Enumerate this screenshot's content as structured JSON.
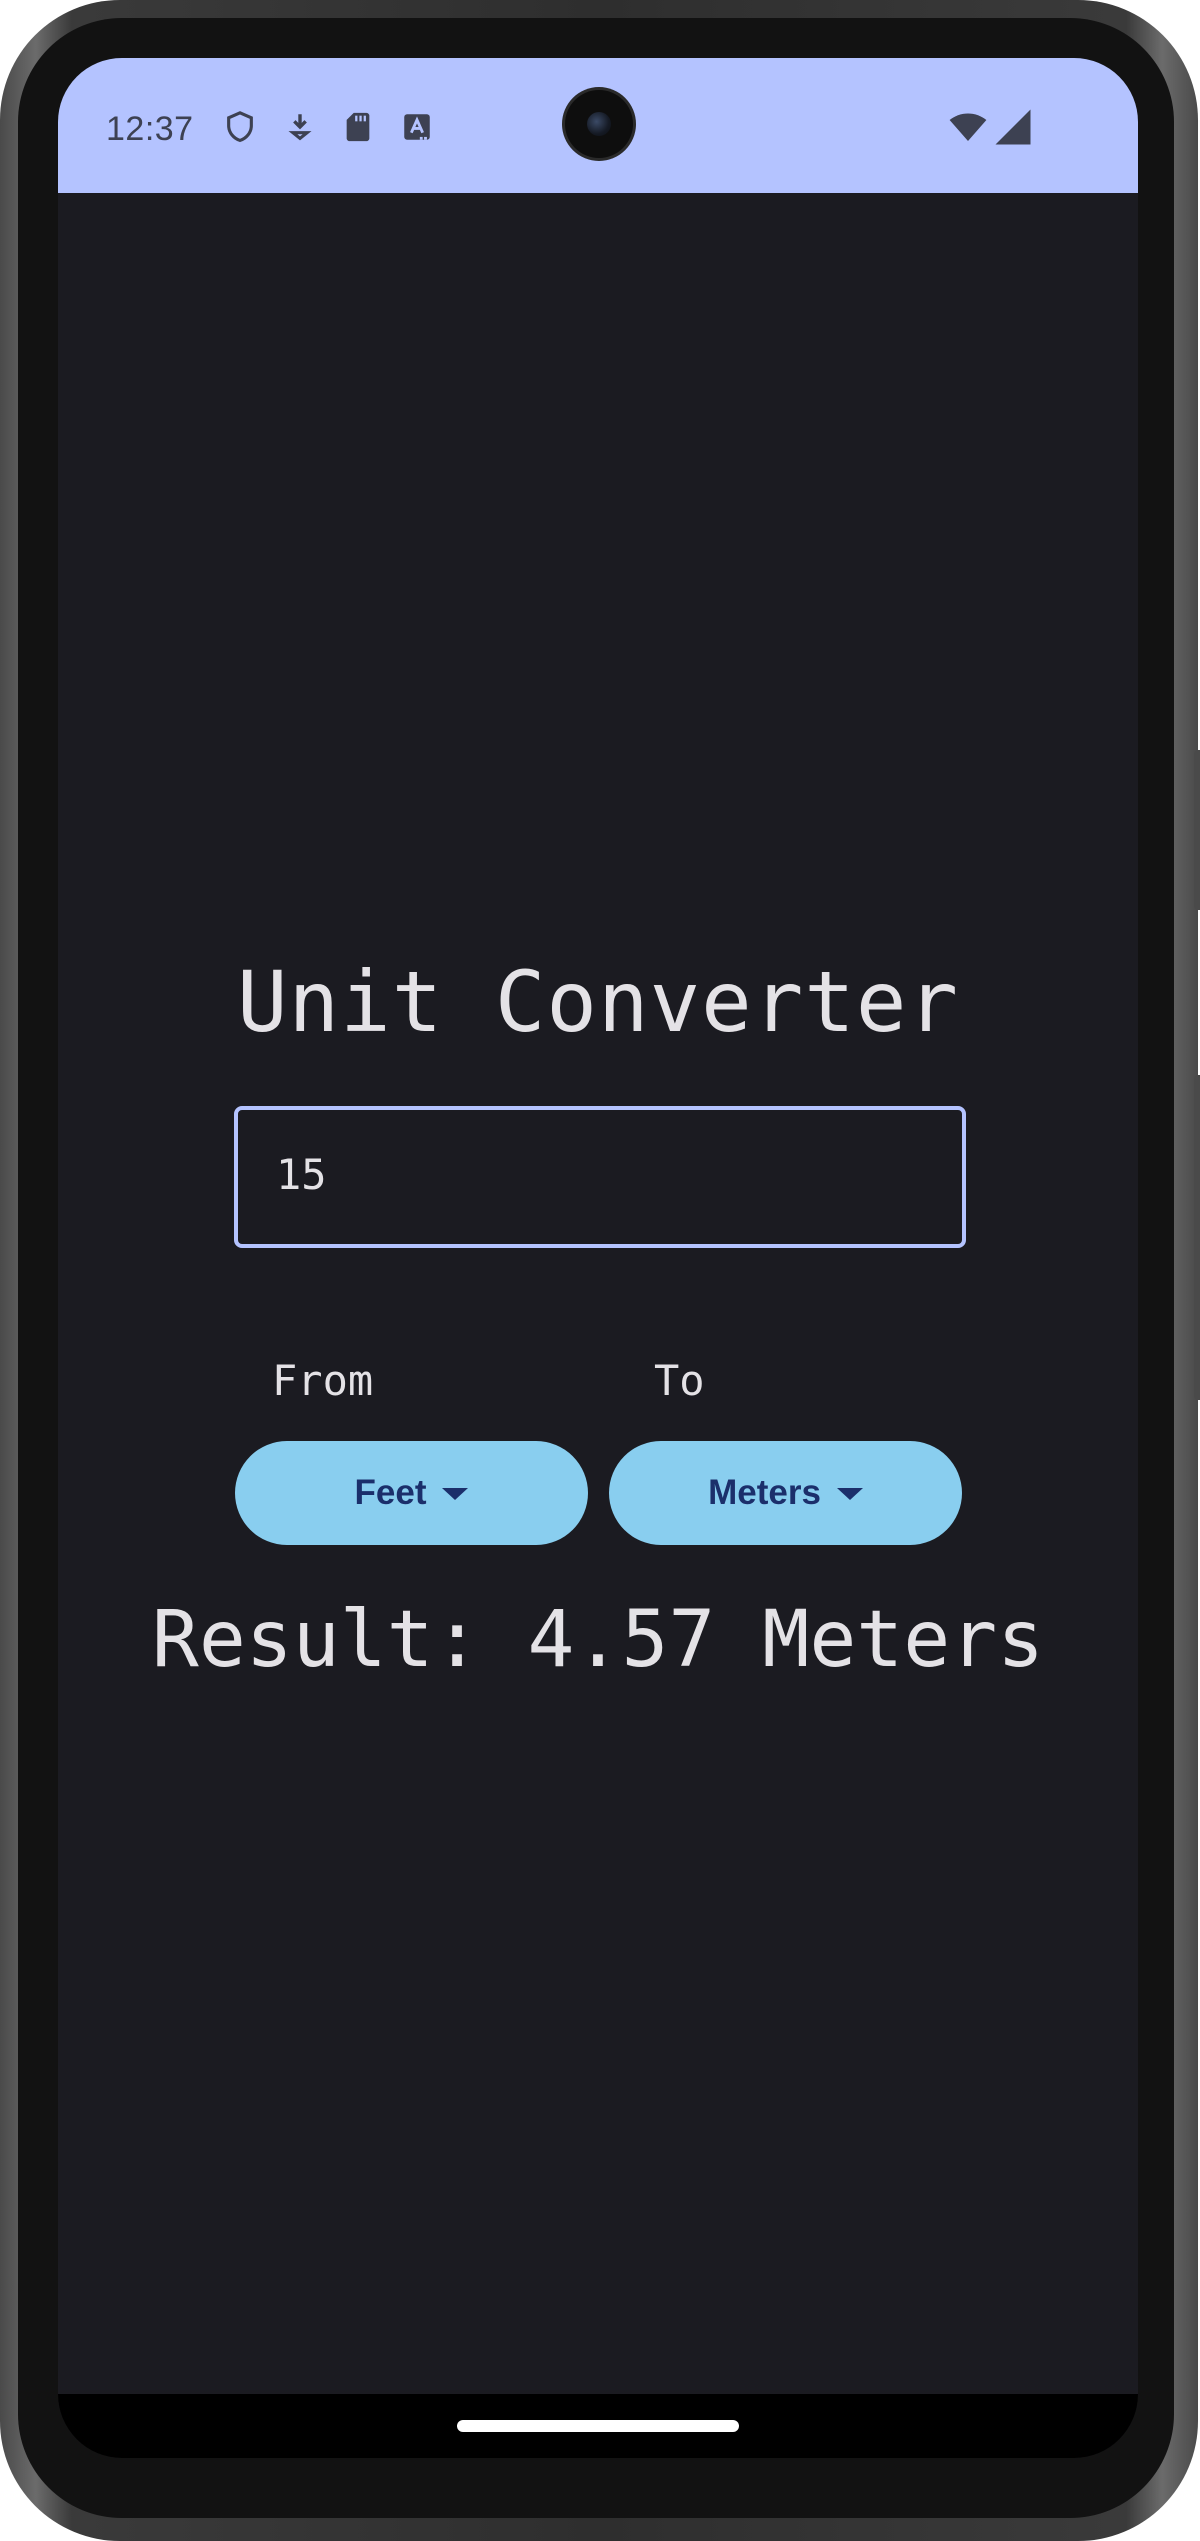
{
  "status_bar": {
    "time": "12:37",
    "icons_left": [
      "shield-icon",
      "download-icon",
      "sd-card-icon",
      "translate-icon"
    ],
    "icons_right": [
      "wifi-icon",
      "signal-icon"
    ]
  },
  "app": {
    "title": "Unit Converter",
    "input": {
      "value": "15",
      "placeholder": ""
    },
    "from_label": "From",
    "to_label": "To",
    "from_unit": "Feet",
    "to_unit": "Meters",
    "result_text": "Result: 4.57 Meters"
  },
  "colors": {
    "status_bar_bg": "#b4c3ff",
    "screen_bg": "#1b1b21",
    "accent": "#b4c3ff",
    "button_bg": "#89ceef",
    "button_text": "#1b2f6b",
    "text": "#e4e2e6"
  }
}
